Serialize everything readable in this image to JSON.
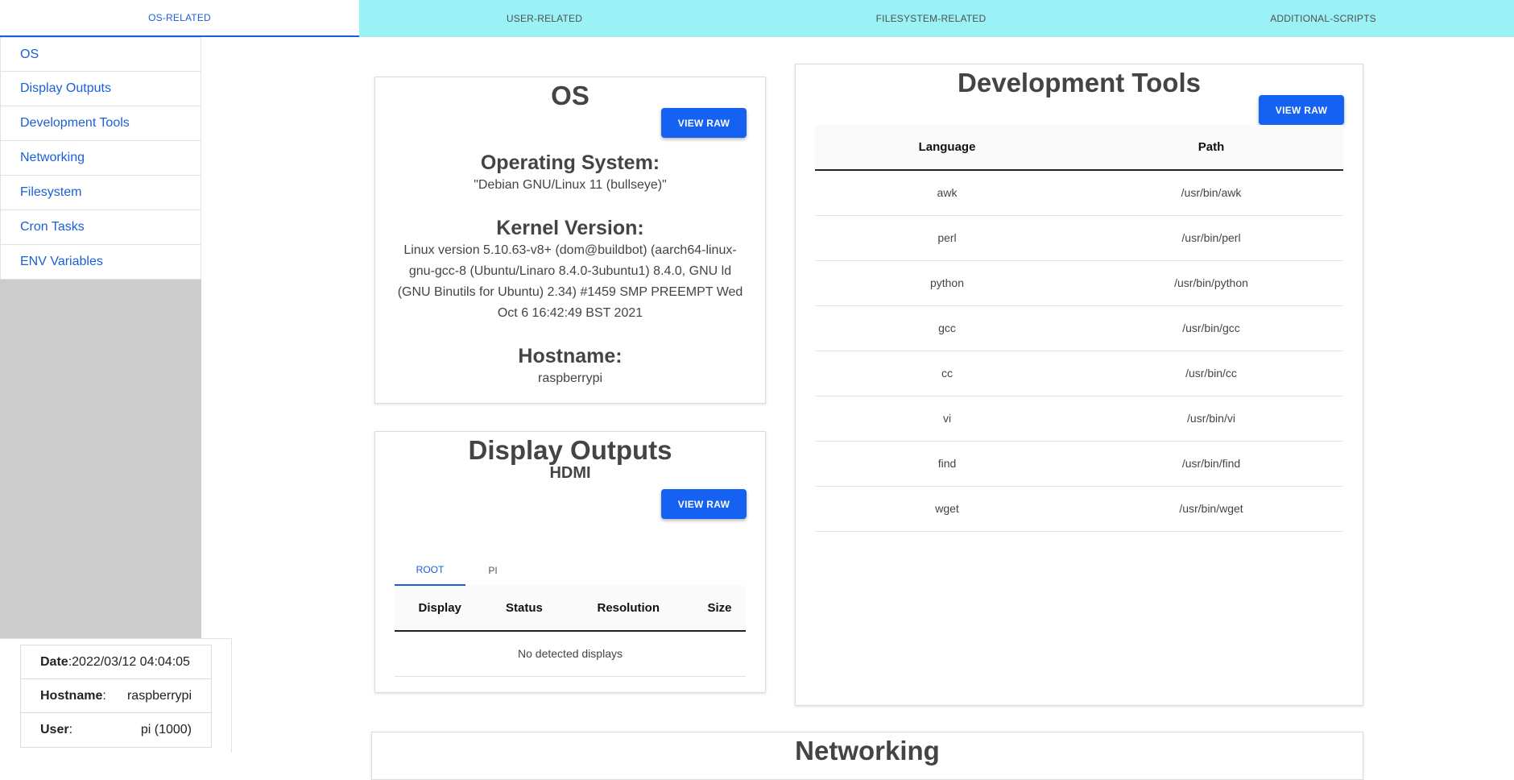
{
  "topnav": {
    "tabs": [
      {
        "label": "OS-RELATED"
      },
      {
        "label": "USER-RELATED"
      },
      {
        "label": "FILESYSTEM-RELATED"
      },
      {
        "label": "ADDITIONAL-SCRIPTS"
      }
    ],
    "active_index": 0
  },
  "sidebar": {
    "items": [
      {
        "label": "OS"
      },
      {
        "label": "Display Outputs"
      },
      {
        "label": "Development Tools"
      },
      {
        "label": "Networking"
      },
      {
        "label": "Filesystem"
      },
      {
        "label": "Cron Tasks"
      },
      {
        "label": "ENV Variables"
      }
    ]
  },
  "info": {
    "date_label": "Date",
    "date_value": "2022/03/12 04:04:05",
    "hostname_label": "Hostname",
    "hostname_value": "raspberrypi",
    "user_label": "User",
    "user_value": "pi (1000)"
  },
  "os_card": {
    "title": "OS",
    "view_raw": "VIEW RAW",
    "os_label": "Operating System:",
    "os_value": "\"Debian GNU/Linux 11 (bullseye)\"",
    "kernel_label": "Kernel Version:",
    "kernel_value": "Linux version 5.10.63-v8+ (dom@buildbot) (aarch64-linux-gnu-gcc-8 (Ubuntu/Linaro 8.4.0-3ubuntu1) 8.4.0, GNU ld (GNU Binutils for Ubuntu) 2.34) #1459 SMP PREEMPT Wed Oct 6 16:42:49 BST 2021",
    "hostname_label": "Hostname:",
    "hostname_value": "raspberrypi"
  },
  "display_card": {
    "title": "Display Outputs",
    "subtitle": "HDMI",
    "view_raw": "VIEW RAW",
    "tabs": [
      {
        "label": "ROOT"
      },
      {
        "label": "PI"
      }
    ],
    "active_tab": 0,
    "columns": [
      "Display",
      "Status",
      "Resolution",
      "Size"
    ],
    "empty_message": "No detected displays"
  },
  "devtools_card": {
    "title": "Development Tools",
    "view_raw": "VIEW RAW",
    "columns": [
      "Language",
      "Path"
    ],
    "rows": [
      {
        "language": "awk",
        "path": "/usr/bin/awk"
      },
      {
        "language": "perl",
        "path": "/usr/bin/perl"
      },
      {
        "language": "python",
        "path": "/usr/bin/python"
      },
      {
        "language": "gcc",
        "path": "/usr/bin/gcc"
      },
      {
        "language": "cc",
        "path": "/usr/bin/cc"
      },
      {
        "language": "vi",
        "path": "/usr/bin/vi"
      },
      {
        "language": "find",
        "path": "/usr/bin/find"
      },
      {
        "language": "wget",
        "path": "/usr/bin/wget"
      }
    ]
  },
  "networking_card": {
    "title": "Networking"
  },
  "colors": {
    "accent": "#1a5fd8",
    "button": "#1561f2",
    "topnav_bg": "#9af2f7",
    "sidebar_bg": "#cccccc"
  }
}
